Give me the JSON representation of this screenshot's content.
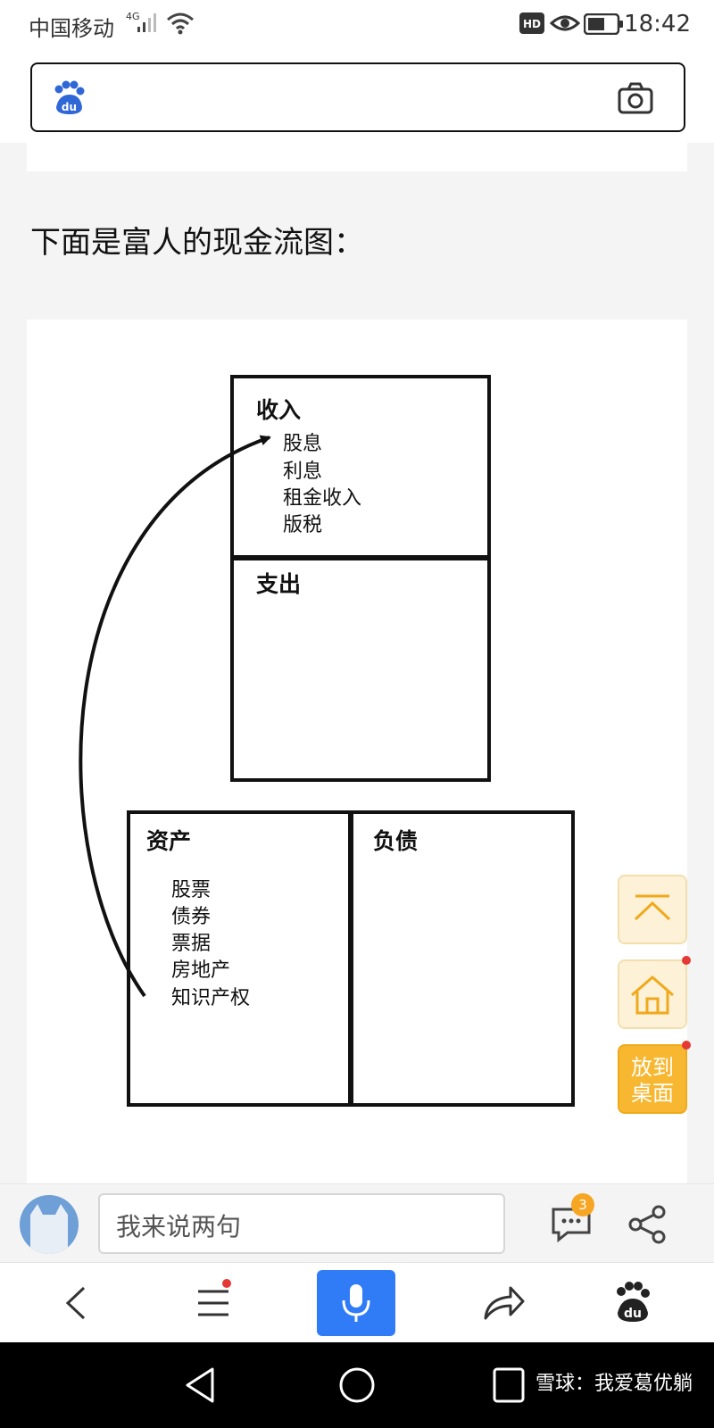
{
  "status_bar": {
    "carrier": "中国移动",
    "network": "4G",
    "hd_label": "HD",
    "time": "18:42"
  },
  "search": {
    "logo_icon": "baidu-paw-icon",
    "camera_icon": "camera-icon",
    "value": ""
  },
  "article": {
    "heading": "下面是富人的现金流图："
  },
  "diagram": {
    "income": {
      "title": "收入",
      "items": [
        "股息",
        "利息",
        "租金收入",
        "版税"
      ]
    },
    "expense": {
      "title": "支出"
    },
    "assets": {
      "title": "资产",
      "items": [
        "股票",
        "债券",
        "票据",
        "房地产",
        "知识产权"
      ]
    },
    "liabilities": {
      "title": "负债"
    }
  },
  "floating_buttons": {
    "back_to_top_icon": "back-to-top-icon",
    "home_icon": "home-icon",
    "desktop_line1": "放到",
    "desktop_line2": "桌面"
  },
  "comment_bar": {
    "placeholder": "我来说两句",
    "comment_count": "3"
  },
  "toolbar": {
    "items": [
      "back-icon",
      "menu-icon",
      "mic-icon",
      "forward-share-icon",
      "baidu-paw-icon"
    ]
  },
  "nav": {
    "watermark": "雪球：我爱葛优躺"
  },
  "colors": {
    "accent_blue": "#2f7cf6",
    "float_orange": "#f7b731",
    "float_light": "#fdf1d8",
    "badge_orange": "#f6a623",
    "notification_red": "#e53935"
  }
}
